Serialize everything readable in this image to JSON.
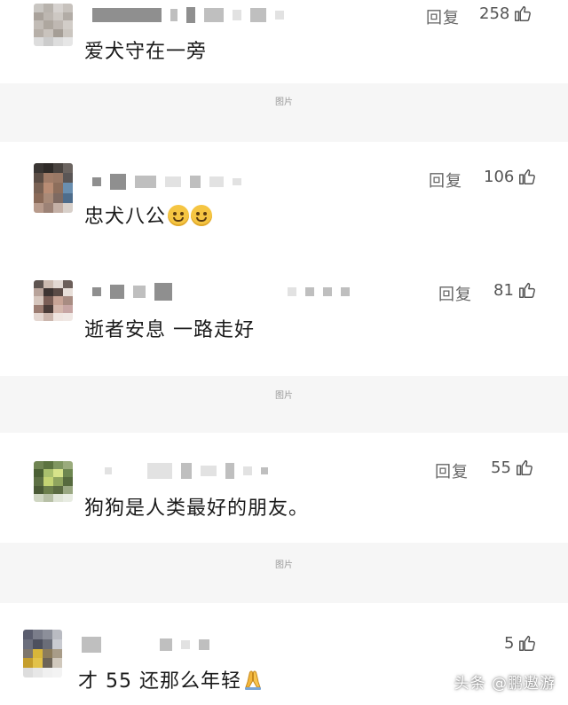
{
  "watermark": "头条 @鹏遨游",
  "image_placeholder": "图片",
  "reply_label": "回复",
  "comments": [
    {
      "text": "爱犬守在一旁",
      "likes": "258",
      "has_reply": true
    },
    {
      "text": "忠犬八公",
      "likes": "106",
      "has_reply": true,
      "emoji": [
        "grin-emoji",
        "grin-emoji"
      ]
    },
    {
      "text": "逝者安息 一路走好",
      "likes": "81",
      "has_reply": true
    },
    {
      "text": "狗狗是人类最好的朋友。",
      "likes": "55",
      "has_reply": true
    },
    {
      "text": "才 55 还那么年轻",
      "likes": "5",
      "has_reply": false,
      "emoji": [
        "pray-emoji"
      ]
    }
  ],
  "colors": {
    "text": "#1a1a1a",
    "meta": "#666666",
    "separator_band": "#f6f6f6",
    "placeholder_text": "#9a9a9a"
  }
}
